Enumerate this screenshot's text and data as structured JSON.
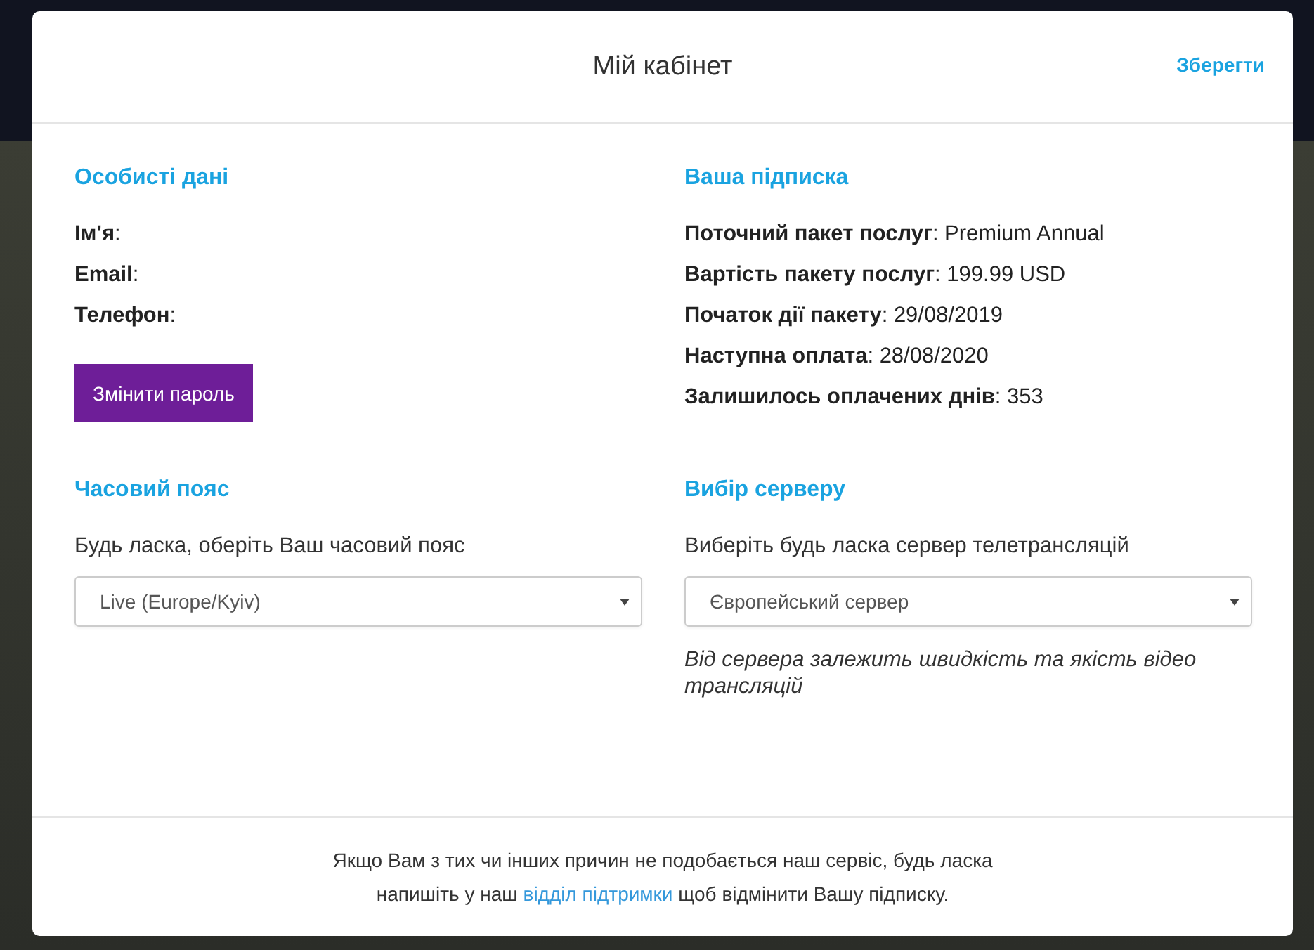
{
  "modal": {
    "title": "Мій кабінет",
    "save_button": "Зберегти"
  },
  "personal": {
    "heading": "Особисті дані",
    "fields": [
      "**Ім'я**:",
      "**Email**:",
      "**Телефон**:"
    ],
    "button": "Змінити пароль"
  },
  "subscription": {
    "heading": "Ваша підписка",
    "rows": [
      "**Поточний пакет послуг**: Premium Annual",
      "**Вартість пакету послуг**: 199.99 USD",
      "**Початок дії пакету**: 29/08/2019",
      "**Наступна оплата**: 28/08/2020",
      "**Залишилось оплачених днів**: 353"
    ]
  },
  "timezone": {
    "heading": "Часовий пояс",
    "prompt": "Будь ласка, оберіть Ваш часовий пояс",
    "select": "Live (Europe/Kyiv)"
  },
  "server": {
    "heading": "Вибір серверу",
    "prompt": "Виберіть будь ласка сервер телетрансляцій",
    "select": "Європейський сервер",
    "note": "Від сервера залежить швидкість та якість відео трансляцій"
  },
  "footer": {
    "line_1": "Якщо Вам з тих чи інших причин не подобається наш сервіс, будь ласка",
    "before_link": "напишіть у наш",
    "link": "відділ підтримки",
    "after_link": "щоб відмінити Вашу підписку."
  }
}
